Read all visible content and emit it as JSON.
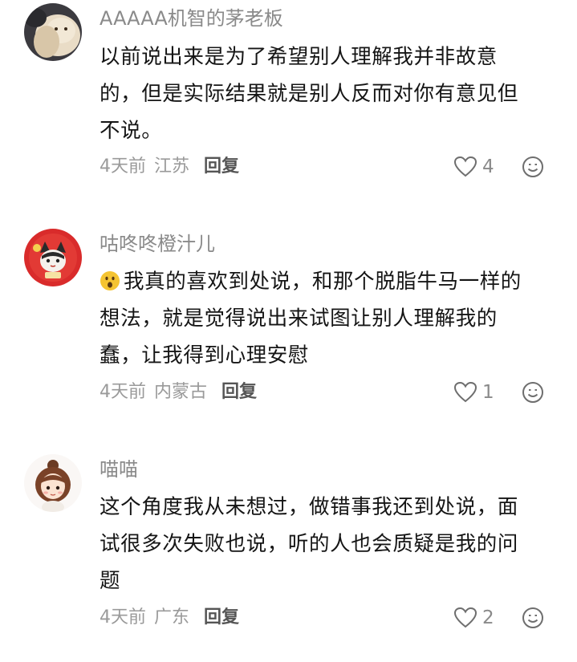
{
  "comments": [
    {
      "username": "AAAAA机智的茅老板",
      "lines": [
        "以前说出来是为了希望别人理解我并非故意",
        "的，但是实际结果就是别人反而对你有意见但",
        "不说。"
      ],
      "time": "4天前",
      "location": "江苏",
      "reply_label": "回复",
      "likes": "4"
    },
    {
      "username": "咕咚咚橙汁儿",
      "lines": [
        "我真的喜欢到处说，和那个脱脂牛马一样的",
        "想法，就是觉得说出来试图让别人理解我的",
        "蠢，让我得到心理安慰"
      ],
      "time": "4天前",
      "location": "内蒙古",
      "reply_label": "回复",
      "likes": "1"
    },
    {
      "username": "喵喵",
      "lines": [
        "这个角度我从未想过，做错事我还到处说，面",
        "试很多次失败也说，听的人也会质疑是我的问",
        "题"
      ],
      "time": "4天前",
      "location": "广东",
      "reply_label": "回复",
      "likes": "2"
    }
  ],
  "icons": {
    "like": "heart-outline-icon",
    "react": "smiley-face-icon",
    "inline_emoji": "frowning-open-mouth-emoji"
  },
  "colors": {
    "username": "#8a8a8a",
    "content": "#151515",
    "meta": "#9a9a9a",
    "reply": "#555555",
    "avatar2_bg": "#d92b2b",
    "emoji": "#f5c431"
  }
}
